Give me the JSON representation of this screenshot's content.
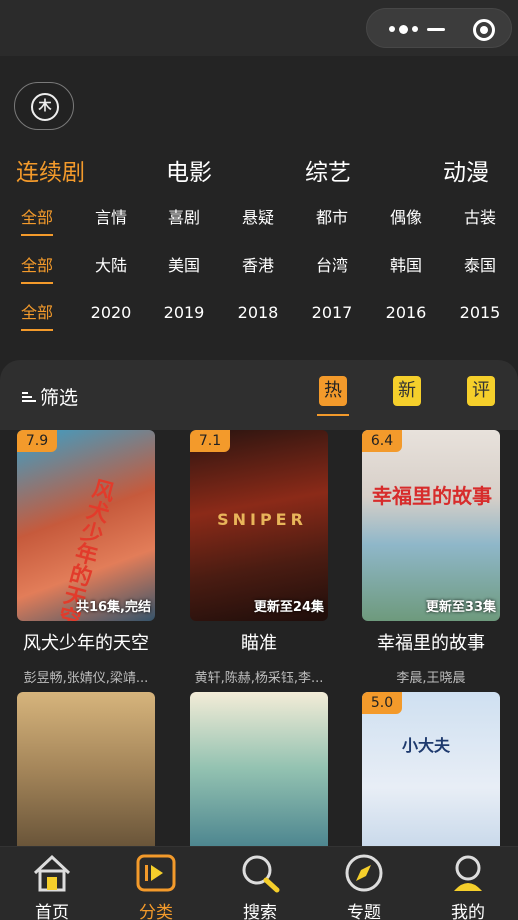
{
  "capsule": {
    "more_icon": "more-dots-icon",
    "minimize_icon": "minimize-icon",
    "close_icon": "target-circle-icon"
  },
  "logo": {
    "icon": "logo-icon",
    "text": "木"
  },
  "categories": [
    {
      "label": "连续剧",
      "active": true
    },
    {
      "label": "电影",
      "active": false
    },
    {
      "label": "综艺",
      "active": false
    },
    {
      "label": "动漫",
      "active": false
    }
  ],
  "genres": [
    "全部",
    "言情",
    "喜剧",
    "悬疑",
    "都市",
    "偶像",
    "古装"
  ],
  "regions": [
    "全部",
    "大陆",
    "美国",
    "香港",
    "台湾",
    "韩国",
    "泰国"
  ],
  "years": [
    "全部",
    "2020",
    "2019",
    "2018",
    "2017",
    "2016",
    "2015"
  ],
  "sortbar": {
    "label": "筛选",
    "hot": "热",
    "new": "新",
    "rating": "评"
  },
  "cards": [
    {
      "score": "7.9",
      "status": "共16集,完结",
      "title": "风犬少年的天空",
      "cast": "彭昱畅,张婧仪,梁靖...",
      "poster_text": "风犬少年的天空"
    },
    {
      "score": "7.1",
      "status": "更新至24集",
      "title": "瞄准",
      "cast": "黄轩,陈赫,杨采钰,李...",
      "poster_text": "SNIPER"
    },
    {
      "score": "6.4",
      "status": "更新至33集",
      "title": "幸福里的故事",
      "cast": "李晨,王晓晨",
      "poster_text": "幸福里的故事"
    },
    {
      "score": "",
      "status": "",
      "title": "",
      "cast": "",
      "poster_text": ""
    },
    {
      "score": "",
      "status": "",
      "title": "",
      "cast": "",
      "poster_text": ""
    },
    {
      "score": "5.0",
      "status": "",
      "title": "",
      "cast": "",
      "poster_text": "小大夫"
    }
  ],
  "tabs": [
    {
      "label": "首页",
      "icon": "home-icon",
      "active": false
    },
    {
      "label": "分类",
      "icon": "category-play-icon",
      "active": true
    },
    {
      "label": "搜索",
      "icon": "search-icon",
      "active": false
    },
    {
      "label": "专题",
      "icon": "compass-icon",
      "active": false
    },
    {
      "label": "我的",
      "icon": "user-icon",
      "active": false
    }
  ],
  "colors": {
    "accent": "#f39a2b",
    "yellow": "#f5cf2b",
    "background": "#232323"
  }
}
